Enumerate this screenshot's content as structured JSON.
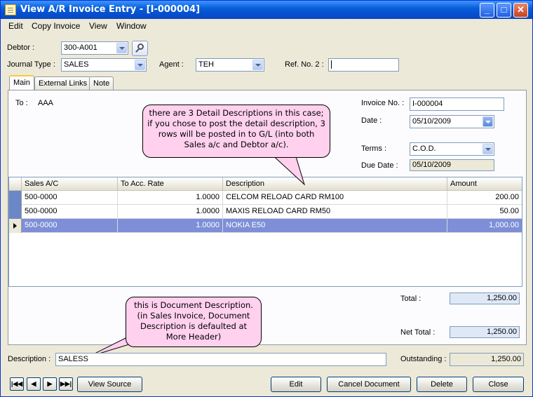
{
  "window": {
    "title": "View A/R Invoice Entry - [I-000004]",
    "minimize": "_",
    "maximize": "□",
    "close": "✕"
  },
  "menu": [
    "Edit",
    "Copy Invoice",
    "View",
    "Window"
  ],
  "header": {
    "debtor_label": "Debtor :",
    "debtor_value": "300-A001",
    "journal_label": "Journal Type :",
    "journal_value": "SALES",
    "agent_label": "Agent :",
    "agent_value": "TEH",
    "ref2_label": "Ref. No. 2 :",
    "ref2_value": ""
  },
  "tabs": [
    "Main",
    "External Links",
    "Note"
  ],
  "main": {
    "to_label": "To :",
    "to_value": "AAA",
    "invoice_no_label": "Invoice No. :",
    "invoice_no_value": "I-000004",
    "date_label": "Date :",
    "date_value": "05/10/2009",
    "terms_label": "Terms :",
    "terms_value": "C.O.D.",
    "due_date_label": "Due Date :",
    "due_date_value": "05/10/2009"
  },
  "grid": {
    "columns": [
      "Sales A/C",
      "To Acc. Rate",
      "Description",
      "Amount"
    ],
    "rows": [
      {
        "sales_ac": "500-0000",
        "rate": "1.0000",
        "description": "CELCOM RELOAD CARD RM100",
        "amount": "200.00"
      },
      {
        "sales_ac": "500-0000",
        "rate": "1.0000",
        "description": "MAXIS RELOAD CARD RM50",
        "amount": "50.00"
      },
      {
        "sales_ac": "500-0000",
        "rate": "1.0000",
        "description": "NOKIA E50",
        "amount": "1,000.00"
      }
    ],
    "selected_row": 2
  },
  "totals": {
    "total_label": "Total :",
    "total_value": "1,250.00",
    "net_total_label": "Net Total :",
    "net_total_value": "1,250.00",
    "outstanding_label": "Outstanding :",
    "outstanding_value": "1,250.00"
  },
  "description": {
    "label": "Description :",
    "value": "SALESS"
  },
  "callouts": {
    "detail": "there are 3 Detail Descriptions in this case; if you chose to post the detail description, 3 rows will be posted in to G/L (into both Sales a/c and Debtor a/c).",
    "document": "this is Document Description. (in Sales Invoice, Document Description is defaulted at More Header)"
  },
  "nav": {
    "first": "|◀◀",
    "prev": "◀",
    "next": "▶",
    "last": "▶▶|"
  },
  "buttons": {
    "view_source": "View Source",
    "edit": "Edit",
    "cancel_document": "Cancel Document",
    "delete": "Delete",
    "close": "Close"
  },
  "colors": {
    "titlebar": "#0a5fd8",
    "selected_row": "#7e8fd8",
    "callout_fill": "#ffd1ee",
    "tab_highlight": "#ffc83c"
  }
}
